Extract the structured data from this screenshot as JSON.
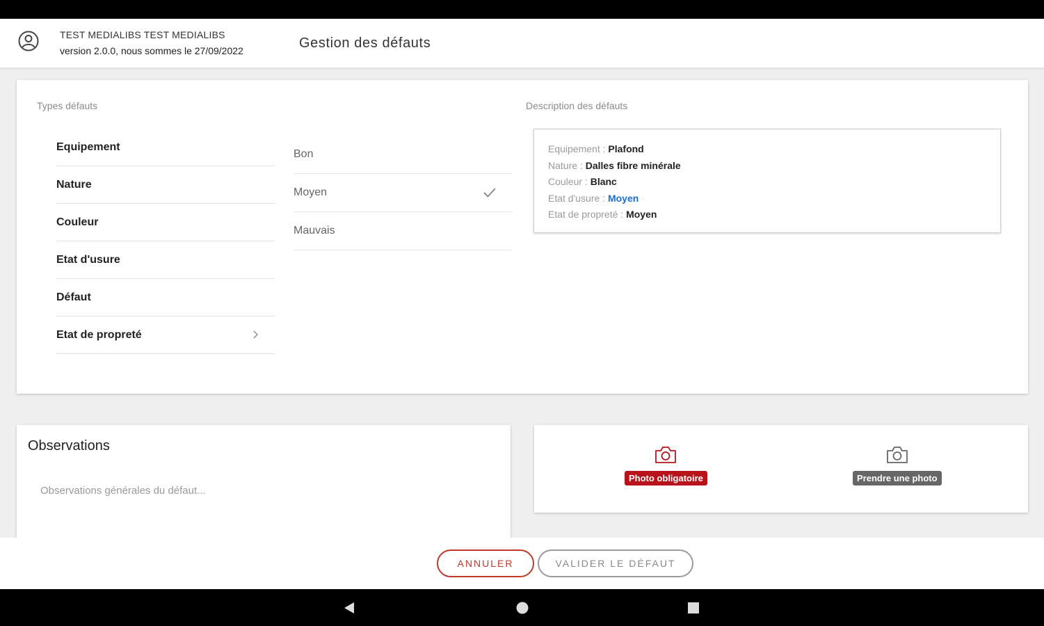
{
  "header": {
    "user_name": "TEST MEDIALIBS TEST MEDIALIBS",
    "version_line": "version 2.0.0, nous sommes le 27/09/2022",
    "title": "Gestion des défauts"
  },
  "types": {
    "label": "Types défauts",
    "categories": [
      {
        "label": "Equipement"
      },
      {
        "label": "Nature"
      },
      {
        "label": "Couleur"
      },
      {
        "label": "Etat d'usure"
      },
      {
        "label": "Défaut"
      },
      {
        "label": "Etat de propreté"
      }
    ],
    "options": [
      {
        "label": "Bon",
        "selected": false
      },
      {
        "label": "Moyen",
        "selected": true
      },
      {
        "label": "Mauvais",
        "selected": false
      }
    ]
  },
  "description": {
    "label": "Description des défauts",
    "rows": [
      {
        "key": "Equipement : ",
        "value": "Plafond"
      },
      {
        "key": "Nature : ",
        "value": "Dalles fibre minérale"
      },
      {
        "key": "Couleur : ",
        "value": "Blanc"
      },
      {
        "key": "Etat d'usure : ",
        "value": "Moyen"
      },
      {
        "key": "Etat de propreté : ",
        "value": "Moyen"
      }
    ]
  },
  "observations": {
    "title": "Observations",
    "placeholder": "Observations générales du défaut...",
    "value": ""
  },
  "photos": {
    "required_label": "Photo obligatoire",
    "take_label": "Prendre une photo"
  },
  "actions": {
    "cancel_label": "ANNULER",
    "validate_label": "VALIDER LE DÉFAUT"
  },
  "colors": {
    "accent_red": "#b8121b",
    "link_blue": "#1a6fd6"
  },
  "icons": {
    "user": "account-circle-icon",
    "chevron": "chevron-right-icon",
    "check": "check-icon",
    "camera": "camera-icon",
    "nav_back": "nav-back-icon",
    "nav_home": "nav-home-icon",
    "nav_recents": "nav-recents-icon"
  }
}
